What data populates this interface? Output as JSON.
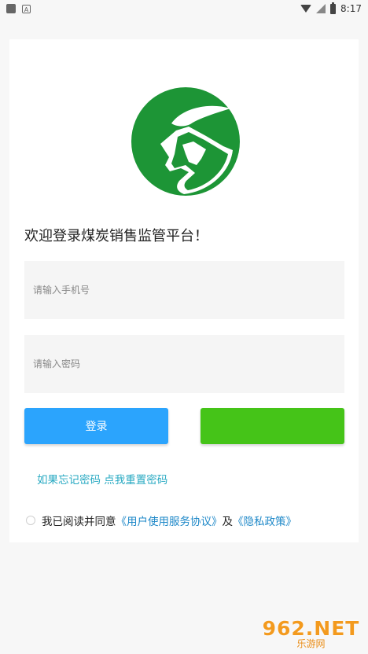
{
  "status_bar": {
    "time": "8:17",
    "app_letter": "A"
  },
  "welcome_text": "欢迎登录煤炭销售监管平台！",
  "phone_field": {
    "placeholder": "请输入手机号",
    "value": ""
  },
  "password_field": {
    "placeholder": "请输入密码",
    "value": ""
  },
  "login_button": {
    "label": "登录"
  },
  "secondary_button": {
    "label": ""
  },
  "forgot_text": "如果忘记密码 点我重置密码",
  "agreement": {
    "prefix": "我已阅读并同意",
    "terms_link": "《用户使用服务协议》",
    "joiner": "及",
    "privacy_link": "《隐私政策》",
    "checked": false
  },
  "watermark": {
    "main": "962.NET",
    "sub": "乐游网"
  },
  "colors": {
    "login_blue": "#2ba4fd",
    "action_green": "#45c418",
    "logo_green": "#1d9536",
    "link_teal": "#27a9c2",
    "link_blue": "#1e88c8"
  },
  "icons": {
    "logo": "green-leaf-mountain-logo",
    "status_left": [
      "notification-square-icon",
      "app-a-icon"
    ],
    "status_right": [
      "wifi-icon",
      "no-signal-icon",
      "battery-icon"
    ]
  }
}
